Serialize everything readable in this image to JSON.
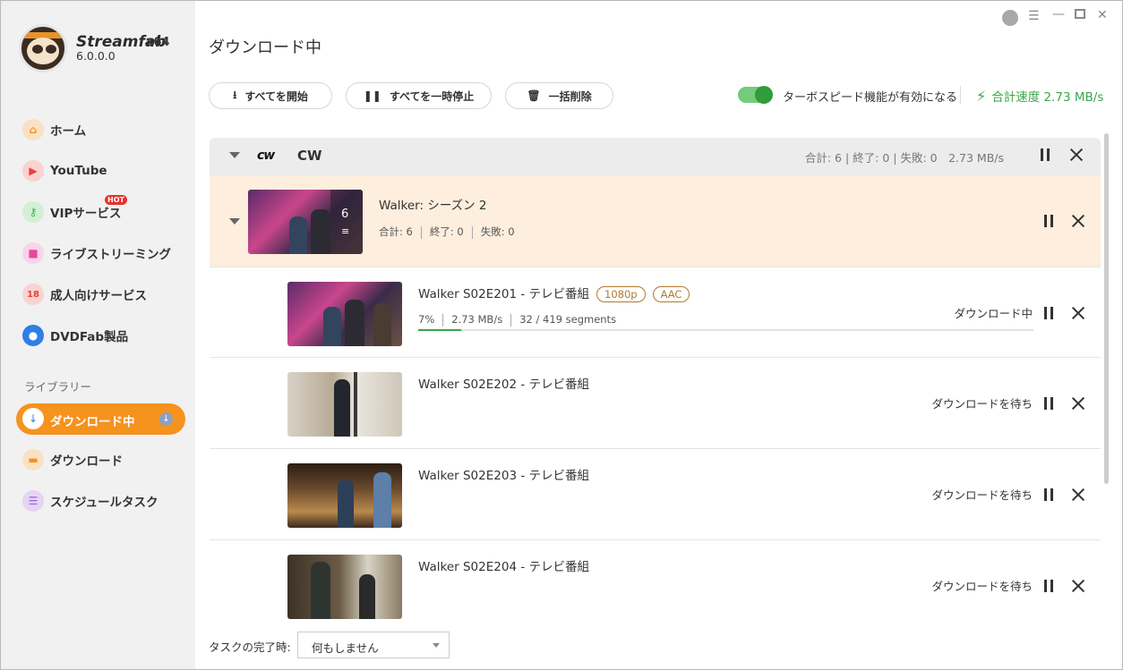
{
  "app": {
    "brand": "Streamfab",
    "arch": "x64",
    "version": "6.0.0.0"
  },
  "window_controls": [
    "clock-icon",
    "menu-icon",
    "minimize-icon",
    "maximize-icon",
    "close-icon"
  ],
  "sidebar": {
    "items": [
      {
        "label": "ホーム",
        "icon": "home-icon",
        "color": "#f6921e"
      },
      {
        "label": "YouTube",
        "icon": "youtube-icon",
        "color": "#e8403a"
      },
      {
        "label": "VIPサービス",
        "icon": "key-icon",
        "color": "#3ab449",
        "badge": "HOT"
      },
      {
        "label": "ライブストリーミング",
        "icon": "camera-icon",
        "color": "#e8459c"
      },
      {
        "label": "成人向けサービス",
        "icon": "18-icon",
        "color": "#e8403a"
      },
      {
        "label": "DVDFab製品",
        "icon": "dvdfab-icon",
        "color": "#2f7ee5"
      }
    ],
    "library_label": "ライブラリー",
    "library": [
      {
        "label": "ダウンロード中",
        "icon": "download-icon",
        "active": true
      },
      {
        "label": "ダウンロード",
        "icon": "folder-icon",
        "color": "#f6921e"
      },
      {
        "label": "スケジュールタスク",
        "icon": "schedule-icon",
        "color": "#9a5fd0"
      }
    ]
  },
  "main": {
    "title": "ダウンロード中",
    "toolbar": {
      "start_all": "すべてを開始",
      "pause_all": "すべてを一時停止",
      "delete_all": "一括削除"
    },
    "turbo": {
      "enabled": true,
      "label": "ターボスピード機能が有効になる"
    },
    "total_speed": "合計速度 2.73 MB/s",
    "group": {
      "logo": "cw",
      "name": "CW",
      "stats": "合計: 6 | 終了: 0 | 失敗: 0　2.73 MB/s"
    },
    "season": {
      "title": "Walker: シーズン 2",
      "count": "6",
      "total": "合計: 6",
      "done": "終了: 0",
      "failed": "失敗: 0"
    },
    "episodes": [
      {
        "title": "Walker S02E201 - テレビ番組",
        "tags": [
          "1080p",
          "AAC"
        ],
        "percent": "7%",
        "progress": 0.07,
        "speed": "2.73 MB/s",
        "segments": "32 / 419 segments",
        "status": "ダウンロード中"
      },
      {
        "title": "Walker S02E202 - テレビ番組",
        "status": "ダウンロードを待ち"
      },
      {
        "title": "Walker S02E203 - テレビ番組",
        "status": "ダウンロードを待ち"
      },
      {
        "title": "Walker S02E204 - テレビ番組",
        "status": "ダウンロードを待ち"
      }
    ]
  },
  "footer": {
    "label": "タスクの完了時:",
    "select_value": "何もしません"
  }
}
